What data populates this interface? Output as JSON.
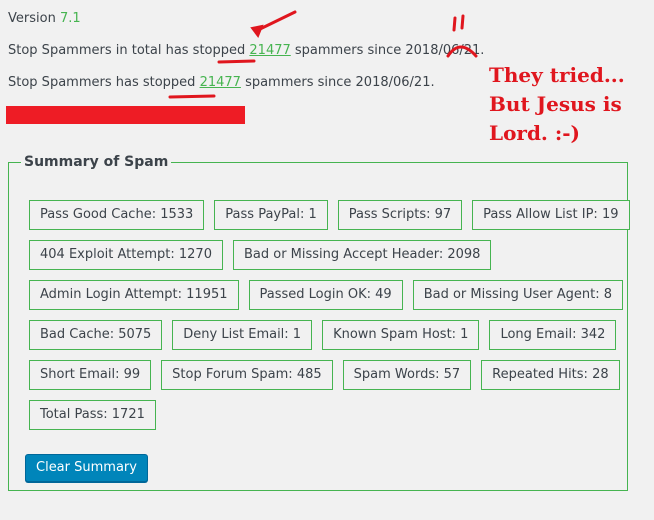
{
  "header": {
    "version_label": "Version",
    "version_value": "7.1",
    "total_prefix": "Stop Spammers in total has stopped",
    "total_count": "21477",
    "total_suffix": "spammers since 2018/06/21.",
    "stopped_prefix": "Stop Spammers has stopped",
    "stopped_count": "21477",
    "stopped_suffix": "spammers since 2018/06/21."
  },
  "annotation": {
    "line1": "They tried...",
    "line2": "But Jesus is",
    "line3": "Lord.   :-)",
    "color": "#e0161e"
  },
  "summary": {
    "legend": "Summary of Spam",
    "rows": [
      [
        "Pass Good Cache: 1533",
        "Pass PayPal: 1",
        "Pass Scripts: 97",
        "Pass Allow List IP: 19"
      ],
      [
        "404 Exploit Attempt: 1270",
        "Bad or Missing Accept Header: 2098"
      ],
      [
        "Admin Login Attempt: 11951",
        "Passed Login OK: 49",
        "Bad or Missing User Agent: 8"
      ],
      [
        "Bad Cache: 5075",
        "Deny List Email: 1",
        "Known Spam Host: 1",
        "Long Email: 342"
      ],
      [
        "Short Email: 99",
        "Stop Forum Spam: 485",
        "Spam Words: 57",
        "Repeated Hits: 28"
      ],
      [
        "Total Pass: 1721"
      ]
    ],
    "clear_button": "Clear Summary"
  },
  "colors": {
    "accent_green": "#46b450",
    "button_blue": "#0085ba",
    "redacted_bar": "#ee1c25"
  }
}
